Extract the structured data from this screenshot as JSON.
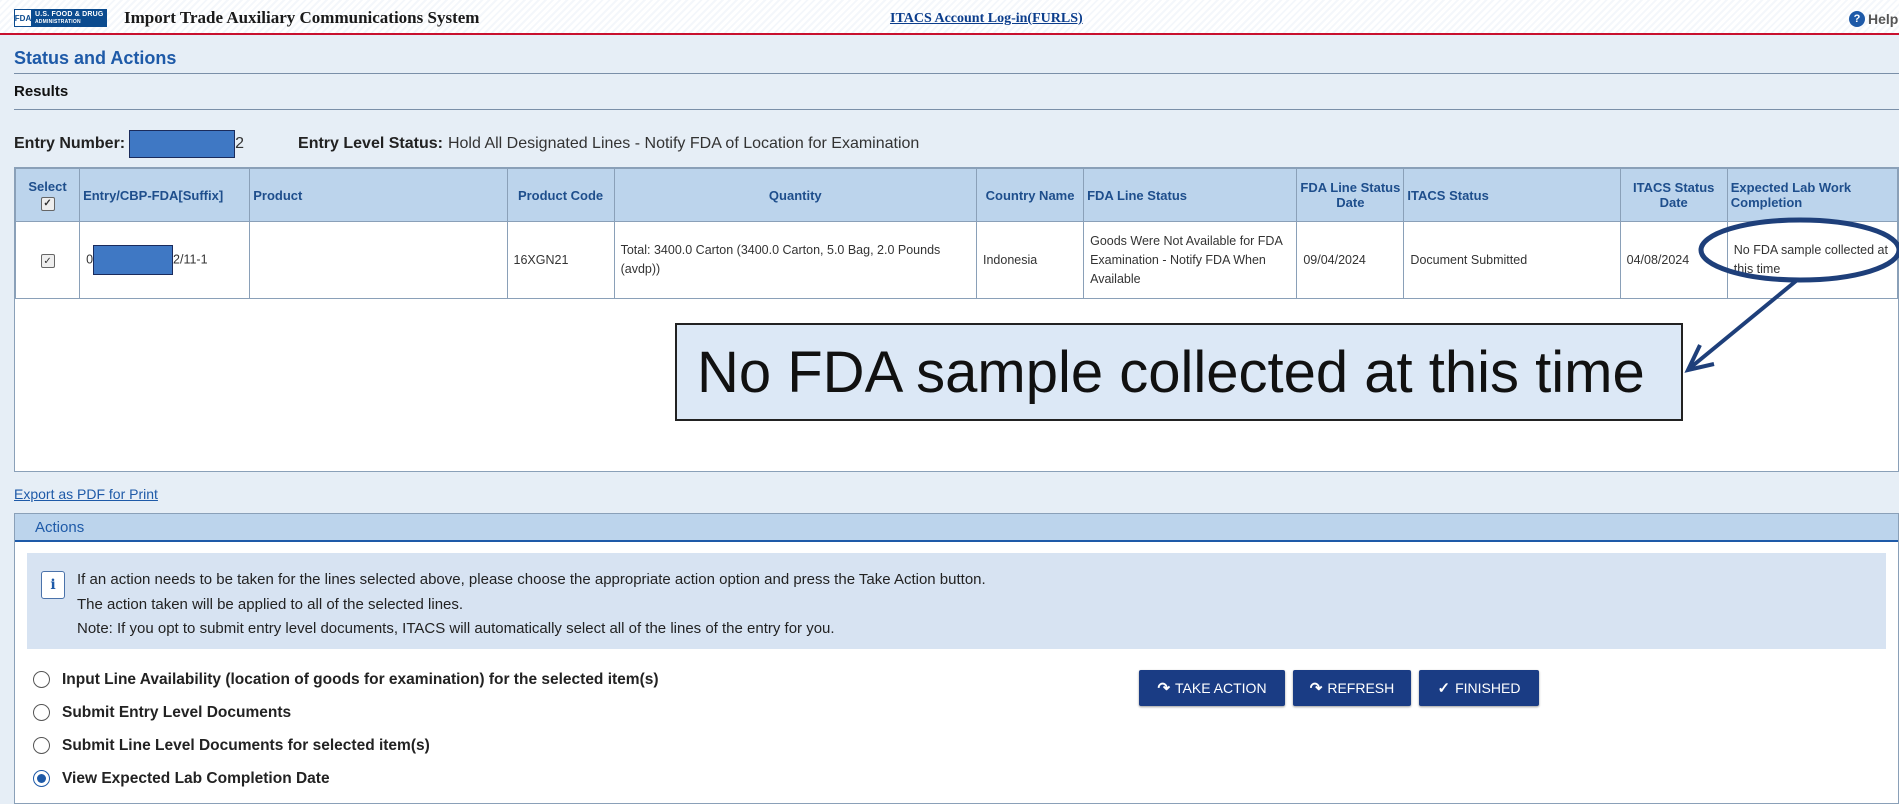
{
  "header": {
    "logo_fda": "FDA",
    "logo_line1": "U.S. FOOD & DRUG",
    "logo_line2": "ADMINISTRATION",
    "app_title": "Import Trade Auxiliary Communications System",
    "login_link": "ITACS Account Log-in(FURLS)",
    "help_label": "Help"
  },
  "page": {
    "section_title": "Status and Actions",
    "results_label": "Results",
    "entry_number_label": "Entry Number:",
    "entry_number_tail": "2",
    "entry_level_status_label": "Entry Level Status:",
    "entry_level_status_value": "Hold All Designated Lines - Notify FDA of Location for Examination"
  },
  "table": {
    "headers": {
      "select": "Select",
      "entry": "Entry/CBP-FDA[Suffix]",
      "product": "Product",
      "product_code": "Product Code",
      "quantity": "Quantity",
      "country": "Country Name",
      "fda_line_status": "FDA Line Status",
      "fda_line_status_date": "FDA Line Status Date",
      "itacs_status": "ITACS Status",
      "itacs_status_date": "ITACS Status Date",
      "expected_lab": "Expected Lab Work Completion"
    },
    "rows": [
      {
        "entry_prefix": "0",
        "entry_suffix": "2/11-1",
        "product": "",
        "product_code": "16XGN21",
        "quantity": "Total: 3400.0 Carton (3400.0 Carton, 5.0 Bag, 2.0 Pounds (avdp))",
        "country": "Indonesia",
        "fda_line_status": "Goods Were Not Available for FDA Examination - Notify FDA When Available",
        "fda_line_status_date": "09/04/2024",
        "itacs_status": "Document Submitted",
        "itacs_status_date": "04/08/2024",
        "expected_lab": "No FDA sample collected at this time"
      }
    ]
  },
  "callout": {
    "text": "No FDA sample collected at this time"
  },
  "export_link": "Export as PDF for Print",
  "actions": {
    "header": "Actions",
    "info_line1": "If an action needs to be taken for the lines selected above, please choose the appropriate action option and press the Take Action button.",
    "info_line2": "The action taken will be applied to all of the selected lines.",
    "info_line3": "Note: If you opt to submit entry level documents, ITACS will automatically select all of the lines of the entry for you.",
    "options": [
      "Input Line Availability (location of goods for examination) for the selected item(s)",
      "Submit Entry Level Documents",
      "Submit Line Level Documents for selected item(s)",
      "View Expected Lab Completion Date"
    ],
    "selected_option": "View Expected Lab Completion Date",
    "buttons": {
      "take_action": "TAKE ACTION",
      "refresh": "REFRESH",
      "finished": "FINISHED"
    }
  },
  "colors": {
    "accent": "#1e5aa8",
    "button": "#1a3c84",
    "header_fill": "#bcd4ec",
    "highlight_ellipse": "#1e3f7a"
  }
}
